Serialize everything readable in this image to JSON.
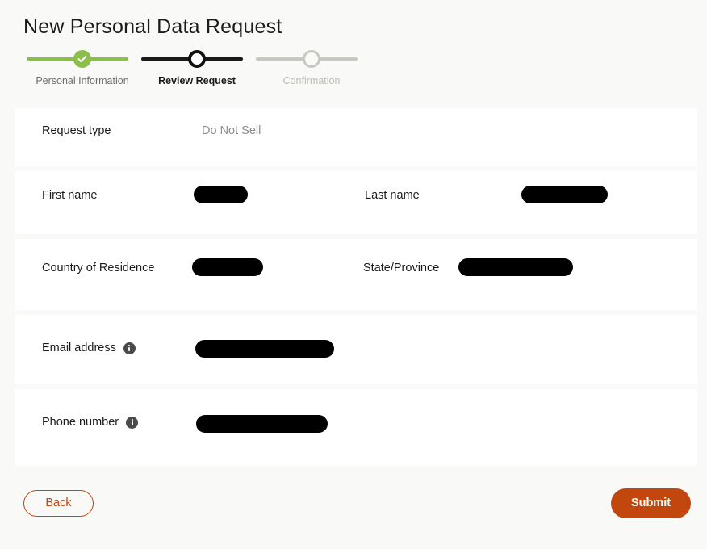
{
  "header": {
    "title": "New Personal Data Request"
  },
  "stepper": {
    "steps": [
      {
        "label": "Personal Information",
        "state": "completed",
        "icon": "check-icon",
        "color": "#8cbe4a"
      },
      {
        "label": "Review Request",
        "state": "current",
        "color": "#1a1a1a"
      },
      {
        "label": "Confirmation",
        "state": "upcoming",
        "color": "#c9c8c0"
      }
    ]
  },
  "form": {
    "request_type": {
      "label": "Request type",
      "value": "Do Not Sell"
    },
    "first_name": {
      "label": "First name",
      "value": "",
      "redacted": true,
      "redaction_width": 67
    },
    "last_name": {
      "label": "Last name",
      "value": "",
      "redacted": true,
      "redaction_width": 107
    },
    "country": {
      "label": "Country of Residence",
      "value": "",
      "redacted": true,
      "redaction_width": 88
    },
    "state_province": {
      "label": "State/Province",
      "value": "",
      "redacted": true,
      "redaction_width": 142
    },
    "email": {
      "label": "Email address",
      "value": "",
      "redacted": true,
      "redaction_width": 172,
      "info_icon": "info-icon"
    },
    "phone": {
      "label": "Phone number",
      "value": "",
      "redacted": true,
      "redaction_width": 163,
      "info_icon": "info-icon"
    }
  },
  "footer": {
    "back_label": "Back",
    "submit_label": "Submit"
  },
  "colors": {
    "page_background": "#f9f9f7",
    "card_background": "#ffffff",
    "accent": "#c2470f",
    "step_complete": "#8cbe4a",
    "step_current": "#1a1a1a",
    "step_upcoming": "#c9c8c0",
    "redaction": "#000000",
    "label_text": "#1b1b1b",
    "value_text": "#8e8e8e"
  }
}
